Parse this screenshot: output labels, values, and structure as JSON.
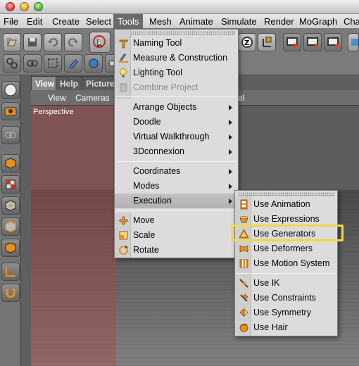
{
  "menubar": {
    "items": [
      "File",
      "Edit",
      "Create",
      "Select",
      "Tools",
      "Mesh",
      "Animate",
      "Simulate",
      "Render",
      "MoGraph",
      "Cha"
    ],
    "active": "Tools"
  },
  "view_tabs": [
    "View",
    "Help",
    "Picture"
  ],
  "view_menu": [
    "View",
    "Cameras",
    "el"
  ],
  "viewport": {
    "label": "Perspective"
  },
  "tools_menu": {
    "items": [
      {
        "label": "Naming Tool",
        "icon": "naming-tool-icon"
      },
      {
        "label": "Measure & Construction",
        "icon": "measure-icon"
      },
      {
        "label": "Lighting Tool",
        "icon": "lighting-tool-icon"
      },
      {
        "label": "Combine Project",
        "icon": "combine-project-icon",
        "disabled": true
      },
      {
        "label": "Arrange Objects",
        "submenu": true
      },
      {
        "label": "Doodle",
        "submenu": true
      },
      {
        "label": "Virtual Walkthrough",
        "submenu": true
      },
      {
        "label": "3Dconnexion",
        "submenu": true
      },
      {
        "label": "Coordinates",
        "submenu": true
      },
      {
        "label": "Modes",
        "submenu": true
      },
      {
        "label": "Execution",
        "submenu": true,
        "highlighted": true
      },
      {
        "label": "Move",
        "icon": "move-icon"
      },
      {
        "label": "Scale",
        "icon": "scale-icon"
      },
      {
        "label": "Rotate",
        "icon": "rotate-icon"
      }
    ]
  },
  "execution_submenu": {
    "items": [
      {
        "label": "Use Animation",
        "icon": "animation-icon"
      },
      {
        "label": "Use Expressions",
        "icon": "expressions-icon"
      },
      {
        "label": "Use Generators",
        "icon": "generators-icon",
        "callout": true
      },
      {
        "label": "Use Deformers",
        "icon": "deformers-icon"
      },
      {
        "label": "Use Motion System",
        "icon": "motion-system-icon"
      },
      {
        "label": "Use IK",
        "icon": "ik-icon"
      },
      {
        "label": "Use Constraints",
        "icon": "constraints-icon"
      },
      {
        "label": "Use Symmetry",
        "icon": "symmetry-icon"
      },
      {
        "label": "Use Hair",
        "icon": "hair-icon"
      }
    ]
  },
  "colors": {
    "callout": "#ecd84a",
    "menu_bg": "#dcdcdc",
    "highlight": "#b8b8b8",
    "icon_orange": "#e8901e"
  }
}
